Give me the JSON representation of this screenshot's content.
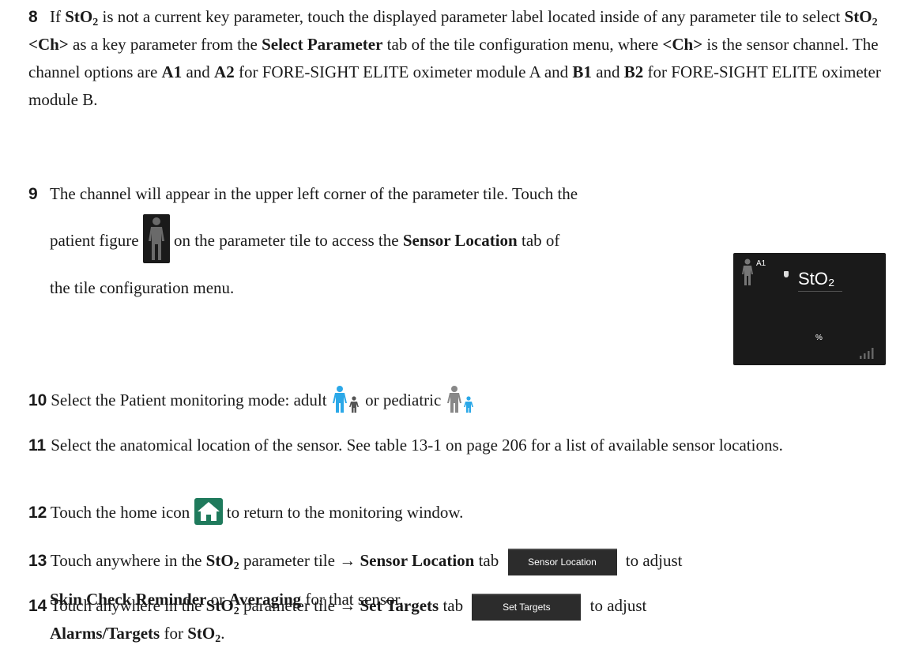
{
  "steps": {
    "s8": {
      "num": "8",
      "t1": "If ",
      "b1": "StO",
      "sub1": "2",
      "t2": " is not a current key parameter, touch the displayed parameter label located inside of any parameter tile to select ",
      "b2": "StO",
      "sub2": "2",
      "b3": " <Ch>",
      "t3": " as a key parameter from the ",
      "b4": "Select Parameter",
      "t4": " tab of the tile configuration menu, where ",
      "b5": "<Ch>",
      "t5": " is the sensor channel. The channel options are ",
      "b6": "A1",
      "t6": " and ",
      "b7": "A2",
      "t7": " for FORE-SIGHT ELITE oximeter module A and ",
      "b8": "B1",
      "t8": " and ",
      "b9": "B2",
      "t9": " for FORE-SIGHT ELITE oximeter module B."
    },
    "s9": {
      "num": "9",
      "t1": "The channel will appear in the upper left corner of the parameter tile. Touch the",
      "t2": "patient figure ",
      "t3": " on the parameter tile to access the ",
      "b1": "Sensor Location",
      "t4": " tab of",
      "t5": "the tile configuration menu."
    },
    "s10": {
      "num": "10",
      "t1": " Select the Patient monitoring mode: adult ",
      "t2": " or pediatric "
    },
    "s11": {
      "num": "11",
      "t1": " Select the anatomical location of the sensor. See table 13-1 on page 206 for a list of available sensor locations."
    },
    "s12": {
      "num": "12",
      "t1": " Touch the home icon ",
      "t2": " to return to the monitoring window."
    },
    "s13": {
      "num": "13",
      "t1": "  Touch anywhere in the ",
      "b1": "StO",
      "sub1": "2",
      "t2": " parameter tile → ",
      "b2": " Sensor Location",
      "t3": " tab ",
      "t4": " to adjust",
      "b3": "Skin Check Reminder",
      "t5": " or ",
      "b4": "Averaging",
      "t6": " for that sensor."
    },
    "s14": {
      "num": "14",
      "t1": " Touch anywhere in the ",
      "b1": "StO",
      "sub1": "2",
      "t2": " parameter tile → ",
      "b2": " Set Targets",
      "t3": " tab ",
      "t4": " to adjust",
      "b3": "Alarms/Targets",
      "t5": " for ",
      "b4": "StO",
      "sub2": "2",
      "t6": "."
    }
  },
  "tile": {
    "channel": "A1",
    "param_label": "StO₂",
    "unit": "%"
  },
  "buttons": {
    "sensor_location": "Sensor Location",
    "set_targets": "Set Targets"
  },
  "icons": {
    "patient_figure": "patient-figure-icon",
    "adult_mode": "adult-mode-icon",
    "pediatric_mode": "pediatric-mode-icon",
    "home": "home-icon",
    "signal": "signal-strength-icon"
  },
  "colors": {
    "active_blue": "#2ba8e8",
    "tile_bg": "#1a1a1a",
    "home_green": "#1f7a5c"
  }
}
